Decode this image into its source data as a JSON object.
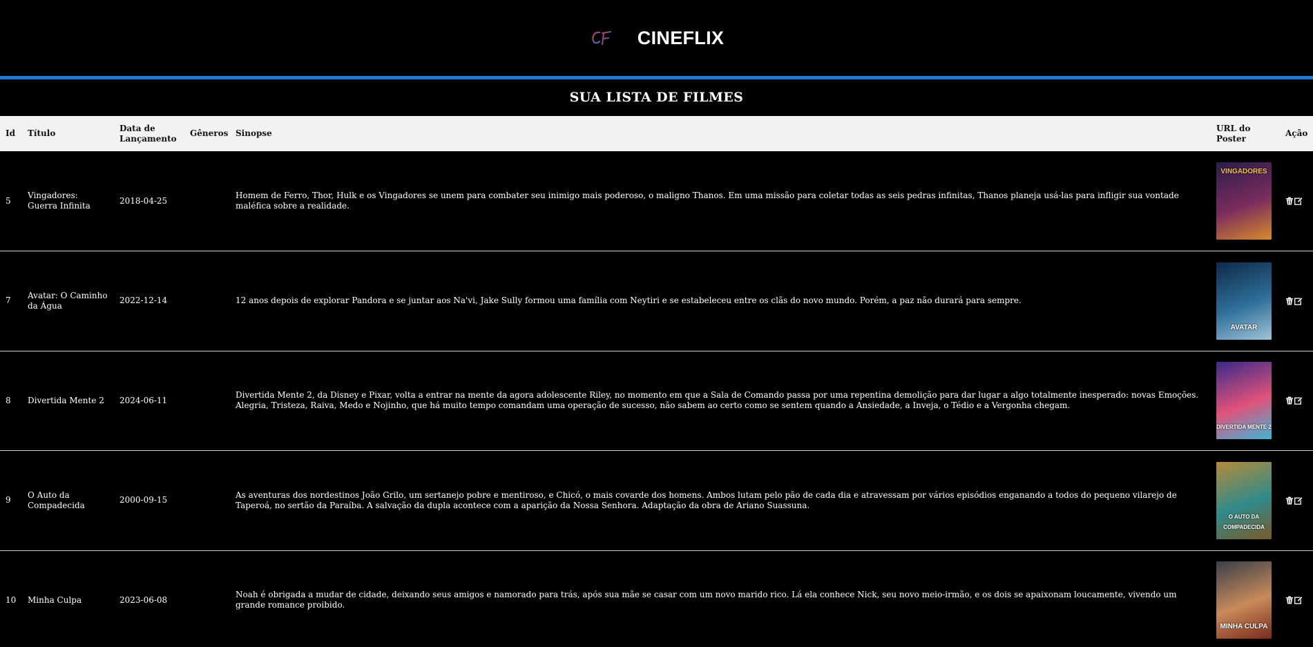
{
  "header": {
    "brand_name": "CINEFLIX",
    "logo_text": "CF"
  },
  "list_title": "SUA LISTA DE FILMES",
  "table": {
    "columns": {
      "id": "Id",
      "titulo": "Título",
      "data": "Data de Lançamento",
      "generos": "Gêneros",
      "sinopse": "Sinopse",
      "poster": "URL do Poster",
      "acao": "Ação"
    },
    "rows": [
      {
        "id": "5",
        "titulo": "Vingadores: Guerra Infinita",
        "data": "2018-04-25",
        "generos": "",
        "sinopse": "Homem de Ferro, Thor, Hulk e os Vingadores se unem para combater seu inimigo mais poderoso, o maligno Thanos. Em uma missão para coletar todas as seis pedras infinitas, Thanos planeja usá-las para infligir sua vontade maléfica sobre a realidade.",
        "poster_text": "VINGADORES",
        "poster_colors": [
          "#2b1d4a",
          "#7a2c5e",
          "#d98a2b"
        ]
      },
      {
        "id": "7",
        "titulo": "Avatar: O Caminho da Água",
        "data": "2022-12-14",
        "generos": "",
        "sinopse": "12 anos depois de explorar Pandora e se juntar aos Na'vi, Jake Sully formou uma família com Neytiri e se estabeleceu entre os clãs do novo mundo. Porém, a paz não durará para sempre.",
        "poster_text": "AVATAR",
        "poster_colors": [
          "#0d2a4a",
          "#2f6f9a",
          "#9fc4d8"
        ]
      },
      {
        "id": "8",
        "titulo": "Divertida Mente 2",
        "data": "2024-06-11",
        "generos": "",
        "sinopse": "Divertida Mente 2, da Disney e Pixar, volta a entrar na mente da agora adolescente Riley, no momento em que a Sala de Comando passa por uma repentina demolição para dar lugar a algo totalmente inesperado: novas Emoções. Alegria, Tristeza, Raiva, Medo e Nojinho, que há muito tempo comandam uma operação de sucesso, não sabem ao certo como se sentem quando a Ansiedade, a Inveja, o Tédio e a Vergonha chegam.",
        "poster_text": "DIVERTIDA MENTE 2",
        "poster_colors": [
          "#3a2a8a",
          "#e0527a",
          "#3fb5d6"
        ]
      },
      {
        "id": "9",
        "titulo": "O Auto da Compadecida",
        "data": "2000-09-15",
        "generos": "",
        "sinopse": "As aventuras dos nordestinos João Grilo, um sertanejo pobre e mentiroso, e Chicó, o mais covarde dos homens. Ambos lutam pelo pão de cada dia e atravessam por vários episódios enganando a todos do pequeno vilarejo de Taperoá, no sertão da Paraíba. A salvação da dupla acontece com a aparição da Nossa Senhora. Adaptação da obra de Ariano Suassuna.",
        "poster_text": "O AUTO DA COMPADECIDA",
        "poster_colors": [
          "#b58a3a",
          "#2f8a8a",
          "#7a5a2a"
        ]
      },
      {
        "id": "10",
        "titulo": "Minha Culpa",
        "data": "2023-06-08",
        "generos": "",
        "sinopse": "Noah é obrigada a mudar de cidade, deixando seus amigos e namorado para trás, após sua mãe se casar com um novo marido rico. Lá ela conhece Nick, seu novo meio-irmão, e os dois se apaixonam loucamente, vivendo um grande romance proibido.",
        "poster_text": "MINHA CULPA",
        "poster_colors": [
          "#3a3f4a",
          "#c88a5a",
          "#7a2a1a"
        ]
      }
    ]
  },
  "icons": {
    "delete": "trash-icon",
    "edit": "edit-icon"
  },
  "colors": {
    "accent": "#1e7ad6",
    "background": "#000000",
    "header_row": "#f2f2f2"
  }
}
